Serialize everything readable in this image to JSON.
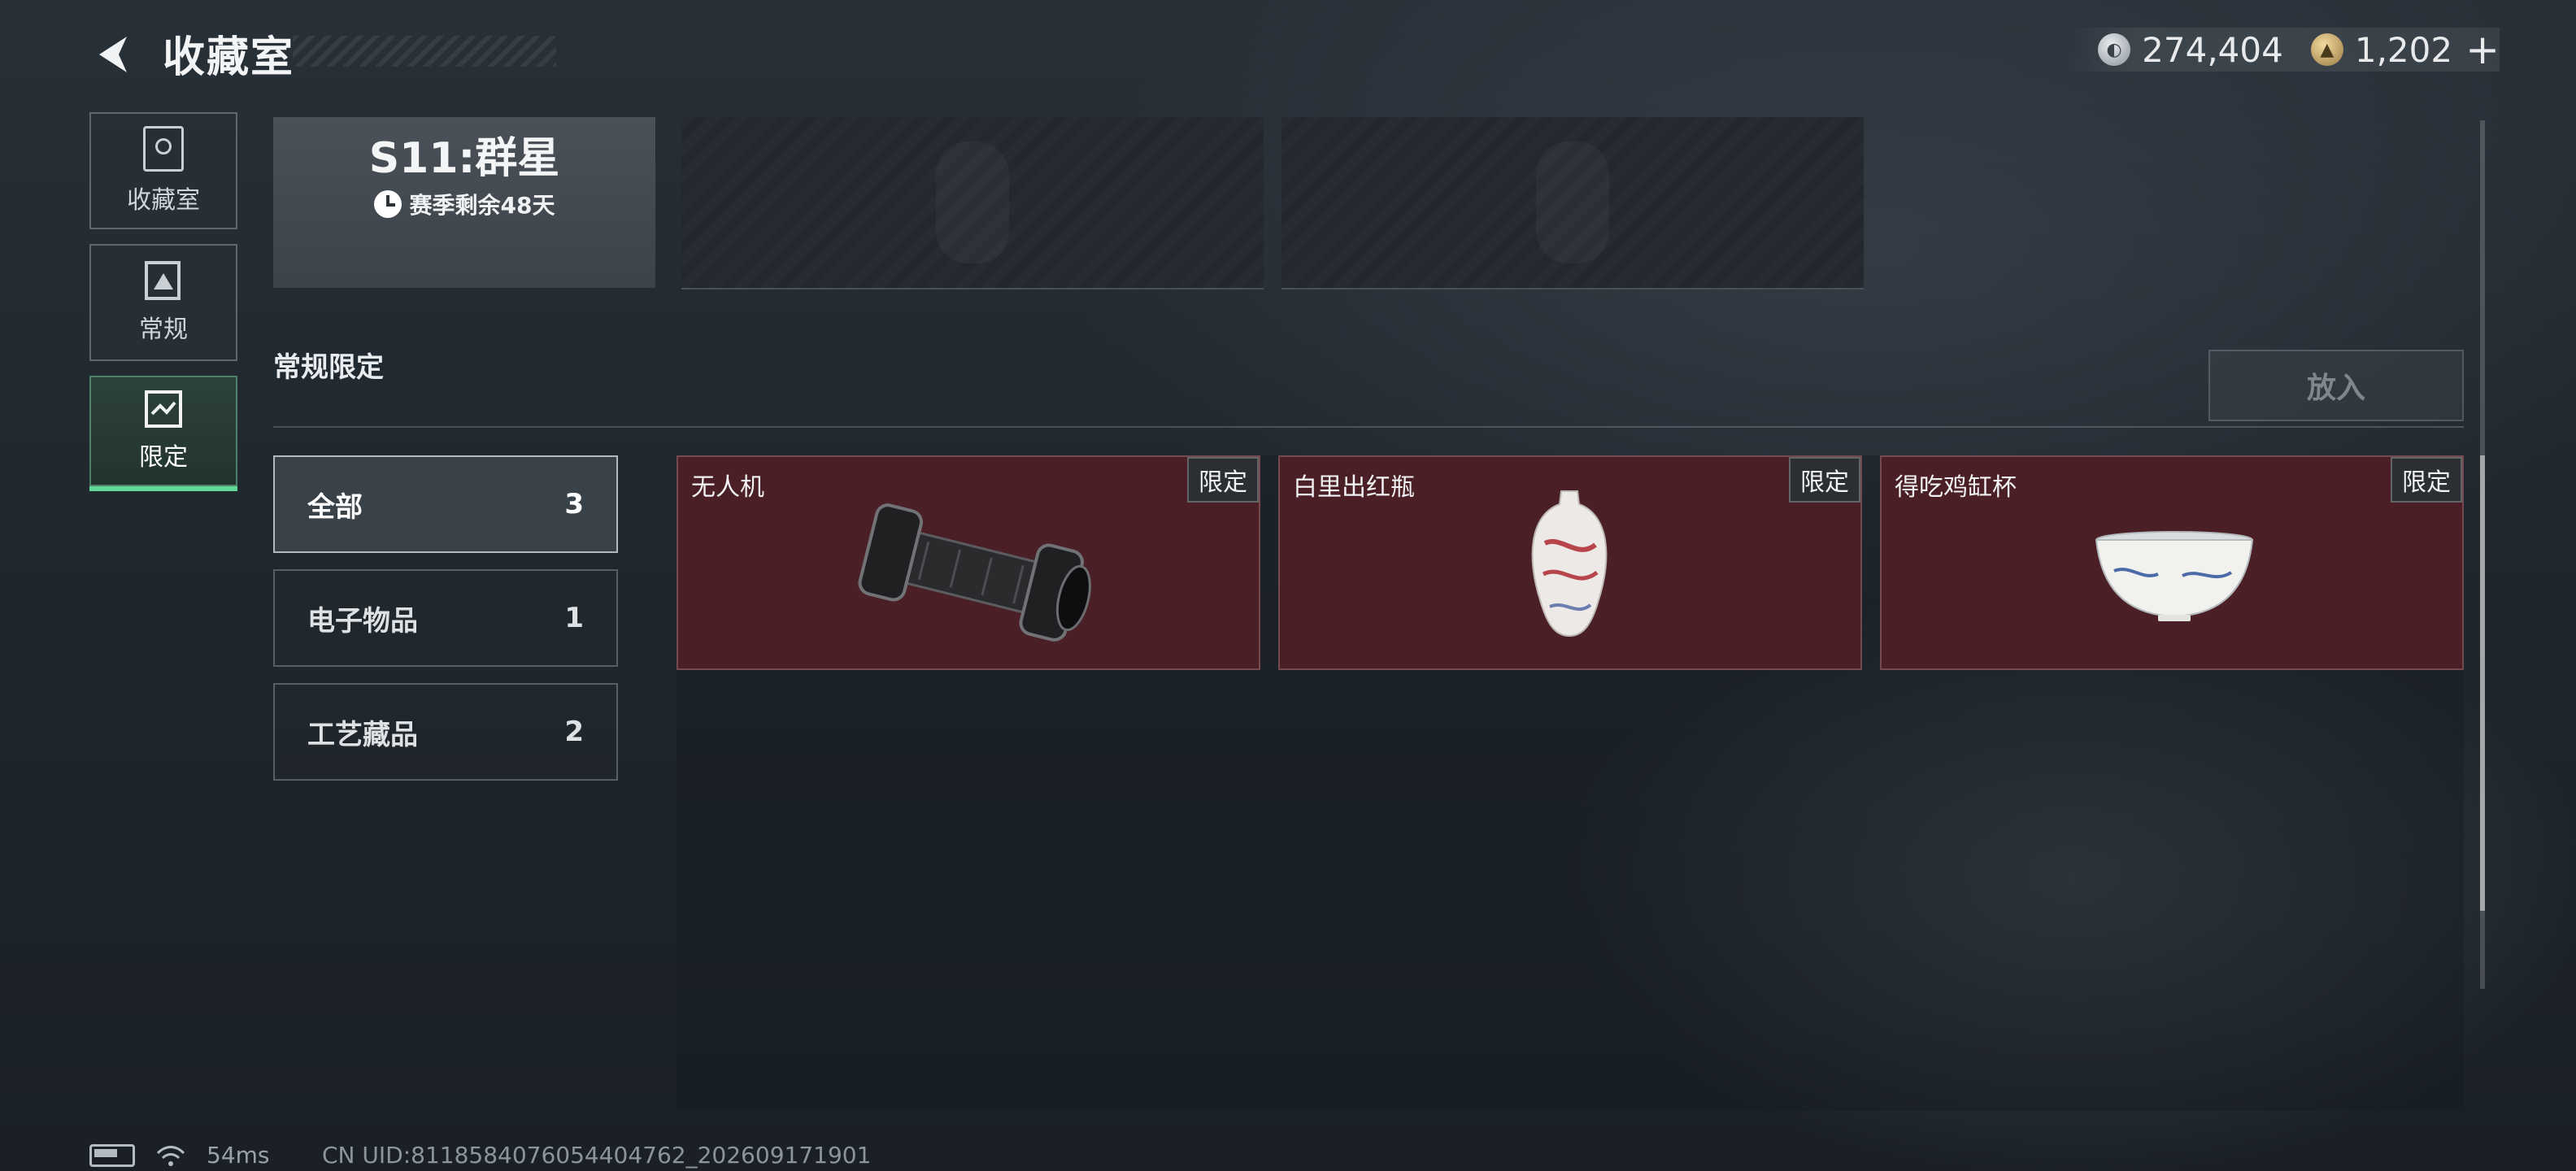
{
  "header": {
    "title": "收藏室",
    "currency": [
      {
        "icon": "silver-coin-icon",
        "value": "274,404"
      },
      {
        "icon": "gold-coin-icon",
        "value": "1,202"
      }
    ],
    "plus": "+"
  },
  "nav": [
    {
      "label": "收藏室",
      "icon": "trophy-case-icon",
      "active": false
    },
    {
      "label": "常规",
      "icon": "card-triangle-icon",
      "active": false
    },
    {
      "label": "限定",
      "icon": "limited-card-icon",
      "active": true
    }
  ],
  "season": {
    "title": "S11:群星",
    "remaining": "赛季剩余48天"
  },
  "section": {
    "title": "常规限定",
    "place_button": "放入"
  },
  "categories": [
    {
      "label": "全部",
      "count": "3",
      "active": true
    },
    {
      "label": "电子物品",
      "count": "1",
      "active": false
    },
    {
      "label": "工艺藏品",
      "count": "2",
      "active": false
    }
  ],
  "items": [
    {
      "name": "无人机",
      "tag": "限定",
      "icon": "drone-engine-icon"
    },
    {
      "name": "白里出红瓶",
      "tag": "限定",
      "icon": "porcelain-vase-icon"
    },
    {
      "name": "得吃鸡缸杯",
      "tag": "限定",
      "icon": "porcelain-cup-icon"
    }
  ],
  "status": {
    "ping": "54ms",
    "uid": "CN UID:8118584076054404762_202609171901"
  },
  "colors": {
    "accent": "#5fd89a",
    "item_bg": "#4a1f25"
  }
}
